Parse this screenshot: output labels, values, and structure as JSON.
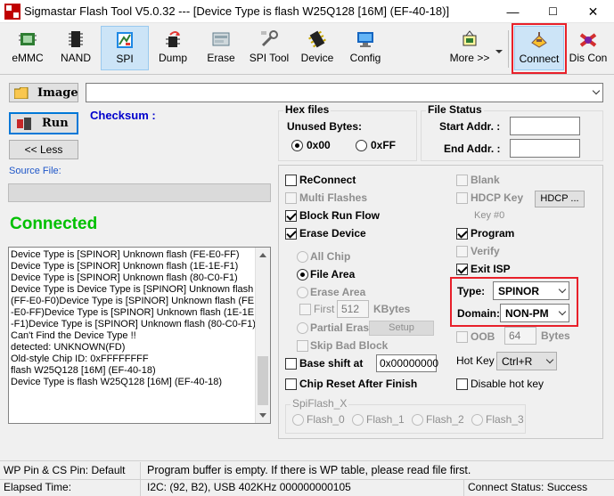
{
  "window": {
    "title": "Sigmastar Flash Tool V5.0.32 --- [Device Type is flash W25Q128 [16M] (EF-40-18)]",
    "controls": {
      "minimize": "—",
      "maximize": "☐",
      "close": "✕"
    }
  },
  "toolbar": {
    "items": [
      {
        "label": "eMMC",
        "icon": "emmc-chip-icon"
      },
      {
        "label": "NAND",
        "icon": "nand-chip-icon"
      },
      {
        "label": "SPI",
        "icon": "spi-icon"
      },
      {
        "label": "Dump",
        "icon": "dump-icon"
      },
      {
        "label": "Erase",
        "icon": "erase-icon"
      },
      {
        "label": "SPI Tool",
        "icon": "spi-tool-icon"
      },
      {
        "label": "Device",
        "icon": "device-icon"
      },
      {
        "label": "Config",
        "icon": "config-icon"
      },
      {
        "label": "More >>",
        "icon": "more-icon"
      },
      {
        "label": "Connect",
        "icon": "connect-icon"
      },
      {
        "label": "Dis Con",
        "icon": "disconnect-icon"
      }
    ],
    "selected": "SPI"
  },
  "left": {
    "image_button": "Image",
    "run_button": "Run",
    "less_button": "<< Less",
    "checksum_label": "Checksum :",
    "source_file_label": "Source File:",
    "source_file_value": "",
    "connection_status": "Connected",
    "log": "Device Type is [SPINOR] Unknown flash (FE-E0-FF)\nDevice Type is [SPINOR] Unknown flash (1E-1E-F1)\nDevice Type is [SPINOR] Unknown flash (80-C0-F1)\nDevice Type is Device Type is [SPINOR] Unknown flash (FF-E0-F0)Device Type is [SPINOR] Unknown flash (FE-E0-FF)Device Type is [SPINOR] Unknown flash (1E-1E-F1)Device Type is [SPINOR] Unknown flash (80-C0-F1)\nCan't Find the Device Type !!\ndetected: UNKNOWN(FD)\nOld-style Chip ID: 0xFFFFFFFF\nflash W25Q128 [16M] (EF-40-18)\nDevice Type is flash W25Q128 [16M] (EF-40-18)"
  },
  "image_path": "",
  "hex_files": {
    "title": "Hex files",
    "unused_bytes_label": "Unused Bytes:",
    "options": [
      "0x00",
      "0xFF"
    ],
    "selected": "0x00"
  },
  "file_status": {
    "title": "File Status",
    "start_addr_label": "Start Addr. :",
    "start_addr_value": "",
    "end_addr_label": "End Addr. :",
    "end_addr_value": ""
  },
  "options": {
    "reconnect": {
      "label": "ReConnect",
      "checked": false
    },
    "multi_flashes": {
      "label": "Multi Flashes",
      "checked": false
    },
    "block_run_flow": {
      "label": "Block Run Flow",
      "checked": true
    },
    "erase_device": {
      "label": "Erase Device",
      "checked": true
    },
    "all_chip": {
      "label": "All Chip"
    },
    "file_area": {
      "label": "File Area"
    },
    "erase_area": {
      "label": "Erase Area"
    },
    "first_label": "First",
    "first_value": "512",
    "kbytes_label": "KBytes",
    "partial_erase": {
      "label": "Partial Erase"
    },
    "setup_button": "Setup",
    "skip_bad_block": {
      "label": "Skip Bad Block"
    },
    "base_shift": {
      "label": "Base shift at",
      "value": "0x00000000"
    },
    "chip_reset": {
      "label": "Chip Reset After Finish"
    },
    "blank": {
      "label": "Blank"
    },
    "hdcp_key": {
      "label": "HDCP Key"
    },
    "hdcp_button": "HDCP ...",
    "key_label": "Key #0",
    "program": {
      "label": "Program",
      "checked": true
    },
    "verify": {
      "label": "Verify"
    },
    "exit_isp": {
      "label": "Exit ISP",
      "checked": true
    },
    "type_label": "Type:",
    "type_value": "SPINOR",
    "domain_label": "Domain:",
    "domain_value": "NON-PM",
    "oob": {
      "label": "OOB",
      "value": "64",
      "unit": "Bytes"
    },
    "hot_key_label": "Hot Key",
    "hot_key_value": "Ctrl+R",
    "disable_hot_key": {
      "label": "Disable hot key"
    },
    "spiflash_title": "SpiFlash_X",
    "spiflash_options": [
      "Flash_0",
      "Flash_1",
      "Flash_2",
      "Flash_3"
    ]
  },
  "statusbar": {
    "wp_pin": "WP Pin & CS Pin: Default",
    "message": "Program buffer is empty. If there is WP table, please read file first.",
    "elapsed": "Elapsed Time:",
    "i2c": "I2C: (92, B2), USB  402KHz  000000000105",
    "connect_status": "Connect Status: Success"
  },
  "colors": {
    "accent_blue": "#0000cc",
    "connected_green": "#00c000",
    "highlight_red": "#e8202a",
    "selected_bg": "#cce4f7"
  }
}
